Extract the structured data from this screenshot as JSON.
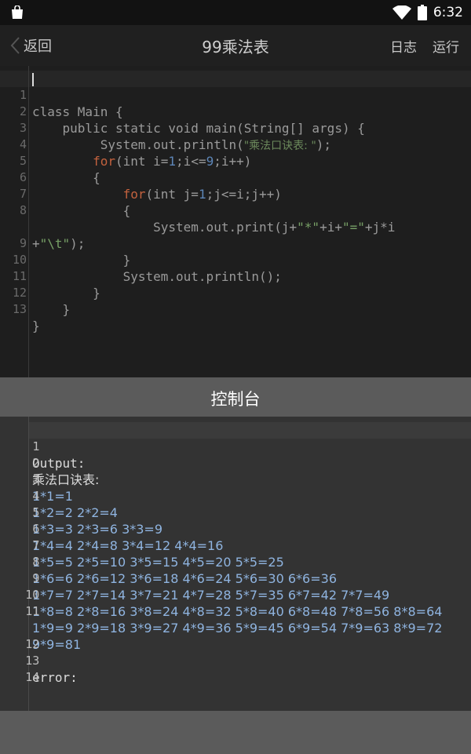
{
  "status_bar": {
    "time": "6:32",
    "icons": [
      "shopping-bag-icon",
      "wifi-icon",
      "battery-icon"
    ]
  },
  "toolbar": {
    "back_label": "返回",
    "title": "99乘法表",
    "log_label": "日志",
    "run_label": "运行"
  },
  "editor": {
    "line_numbers": [
      "1",
      "2",
      "3",
      "4",
      "5",
      "6",
      "7",
      "",
      "8",
      "9",
      "10",
      "11",
      "12",
      "13"
    ],
    "lines": [
      "class Main {",
      "    public static void main(String[] args) {",
      "         System.out.println(\"乘法口诀表: \");",
      "        for(int i=1;i<=9;i++)",
      "        {",
      "            for(int j=1;j<=i;j++)",
      "            {",
      "                System.out.print(j+\"*\"+i+\"=\"+j*i",
      "+\"\\t\");",
      "            }",
      "            System.out.println();",
      "        }",
      "    }",
      "}"
    ]
  },
  "console": {
    "title": "控制台"
  },
  "output": {
    "line_numbers": [
      "1",
      "2",
      "3",
      "4",
      "5",
      "6",
      "7",
      "8",
      "9",
      "10",
      "11",
      "",
      "12",
      "13",
      "14"
    ],
    "lines": [
      "Output:",
      "乘法口诀表:",
      "1*1=1",
      "1*2=2 2*2=4",
      "1*3=3 2*3=6 3*3=9",
      "1*4=4 2*4=8 3*4=12 4*4=16",
      "1*5=5 2*5=10 3*5=15 4*5=20 5*5=25",
      "1*6=6 2*6=12 3*6=18 4*6=24 5*6=30 6*6=36",
      "1*7=7 2*7=14 3*7=21 4*7=28 5*7=35 6*7=42 7*7=49",
      "1*8=8 2*8=16 3*8=24 4*8=32 5*8=40 6*8=48 7*8=56 8*8=64",
      "1*9=9 2*9=18 3*9=27 4*9=36 5*9=45 6*9=54 7*9=63 8*9=72",
      "9*9=81",
      "",
      "error:",
      ""
    ]
  },
  "colors": {
    "keyword": "#c4623e",
    "number": "#5d86b8",
    "string": "#77a066",
    "console_bar": "#5b5b5b"
  }
}
